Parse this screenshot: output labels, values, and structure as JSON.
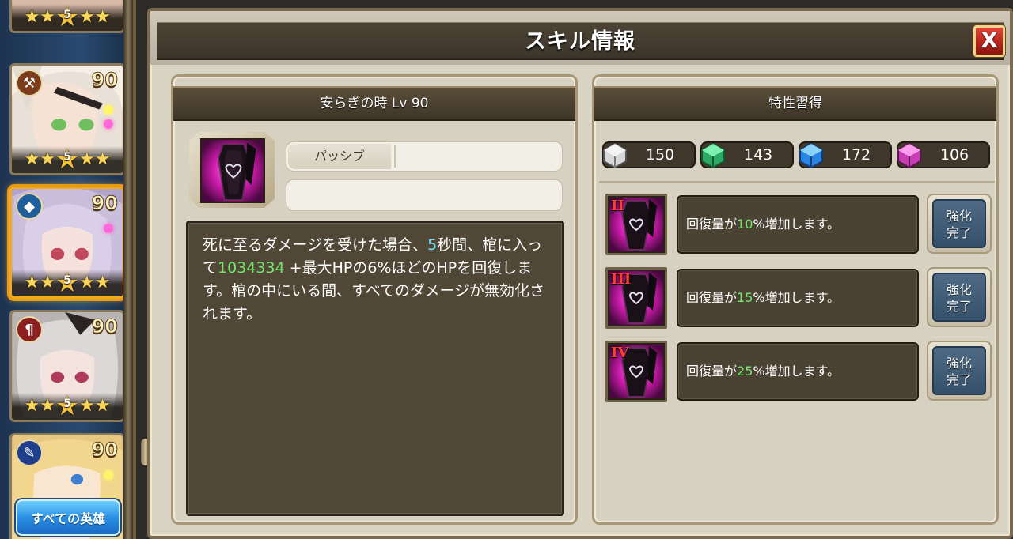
{
  "heroes": [
    {
      "level": "",
      "stars_left": "★★",
      "star_count": "5",
      "stars_right": "★★",
      "class_icon": "none"
    },
    {
      "level": "90",
      "stars_left": "★★",
      "star_count": "5",
      "stars_right": "★★",
      "class_icon": "axe-icon"
    },
    {
      "level": "90",
      "stars_left": "★★",
      "star_count": "5",
      "stars_right": "★★",
      "class_icon": "shield-icon"
    },
    {
      "level": "90",
      "stars_left": "★★",
      "star_count": "5",
      "stars_right": "★★",
      "class_icon": "staff-icon"
    },
    {
      "level": "90",
      "stars_left": "",
      "star_count": "",
      "stars_right": "",
      "class_icon": "gun-icon"
    }
  ],
  "sidebar": {
    "all_heroes_label": "すべての英雄"
  },
  "dialog": {
    "title": "スキル情報",
    "close_label": "X"
  },
  "skill": {
    "header": "安らぎの時 Lv 90",
    "type_label": "パッシブ",
    "description": {
      "p1": "死に至るダメージを受けた場合、",
      "duration": "5",
      "p2": "秒間、棺に入って",
      "heal_amount": "1034334",
      "p3": " +最大HPの6%ほどのHPを回復します。棺の中にいる間、すべてのダメージが無効化されます。"
    }
  },
  "traits": {
    "header": "特性習得",
    "materials": [
      {
        "icon": "silver-cube-icon",
        "count": "150",
        "color": "#9a9a9a"
      },
      {
        "icon": "green-cube-icon",
        "count": "143",
        "color": "#3ec87a"
      },
      {
        "icon": "blue-cube-icon",
        "count": "172",
        "color": "#3aa0ff"
      },
      {
        "icon": "pink-cube-icon",
        "count": "106",
        "color": "#e05ad0"
      }
    ],
    "rows": [
      {
        "numeral": "II",
        "prefix": "回復量が",
        "value": "10",
        "suffix": "%増加します。",
        "status_line1": "強化",
        "status_line2": "完了"
      },
      {
        "numeral": "III",
        "prefix": "回復量が",
        "value": "15",
        "suffix": "%増加します。",
        "status_line1": "強化",
        "status_line2": "完了"
      },
      {
        "numeral": "IV",
        "prefix": "回復量が",
        "value": "25",
        "suffix": "%増加します。",
        "status_line1": "強化",
        "status_line2": "完了"
      }
    ]
  }
}
